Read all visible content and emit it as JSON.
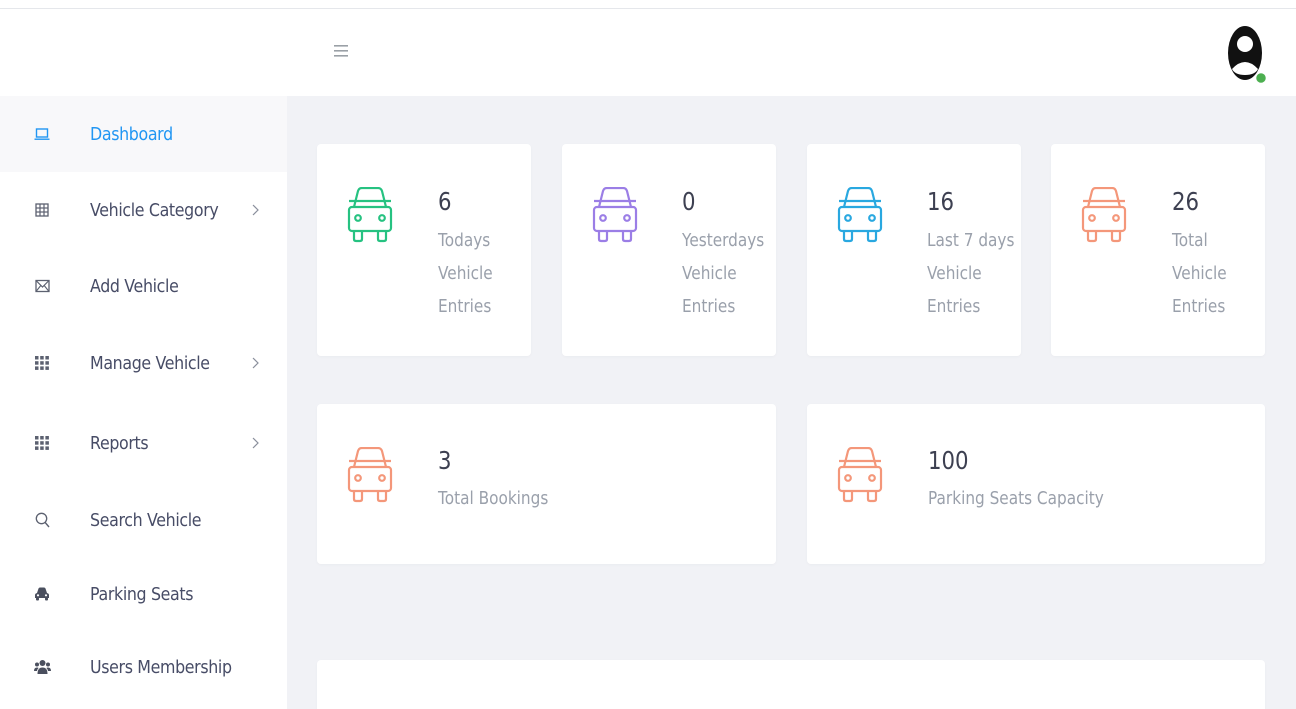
{
  "colors": {
    "accent": "#2196f3",
    "green": "#26c281",
    "purple": "#9b7ee6",
    "blue": "#29a8e0",
    "orange": "#f4977a"
  },
  "header": {
    "menu_icon": "hamburger-icon",
    "avatar_icon": "user-avatar-icon"
  },
  "sidebar": {
    "items": [
      {
        "label": "Dashboard",
        "icon": "laptop-icon",
        "active": true
      },
      {
        "label": "Vehicle Category",
        "icon": "table-grid-icon",
        "has_submenu": true
      },
      {
        "label": "Add Vehicle",
        "icon": "envelope-icon"
      },
      {
        "label": "Manage Vehicle",
        "icon": "apps-grid-icon",
        "has_submenu": true
      },
      {
        "label": "Reports",
        "icon": "apps-grid-icon",
        "has_submenu": true
      },
      {
        "label": "Search Vehicle",
        "icon": "search-icon"
      },
      {
        "label": "Parking Seats",
        "icon": "car-icon"
      },
      {
        "label": "Users Membership",
        "icon": "users-icon"
      }
    ]
  },
  "stats": [
    {
      "value": "6",
      "line1": "Todays",
      "line2": "Vehicle",
      "line3": "Entries",
      "color": "#26c281"
    },
    {
      "value": "0",
      "line1": "Yesterdays",
      "line2": "Vehicle",
      "line3": "Entries",
      "color": "#9b7ee6"
    },
    {
      "value": "16",
      "line1": "Last 7 days",
      "line2": "Vehicle",
      "line3": "Entries",
      "color": "#29a8e0"
    },
    {
      "value": "26",
      "line1": "Total",
      "line2": "Vehicle",
      "line3": "Entries",
      "color": "#f4977a"
    }
  ],
  "summary": [
    {
      "value": "3",
      "label": "Total Bookings",
      "color": "#f4977a"
    },
    {
      "value": "100",
      "label": "Parking Seats Capacity",
      "color": "#f4977a"
    }
  ]
}
